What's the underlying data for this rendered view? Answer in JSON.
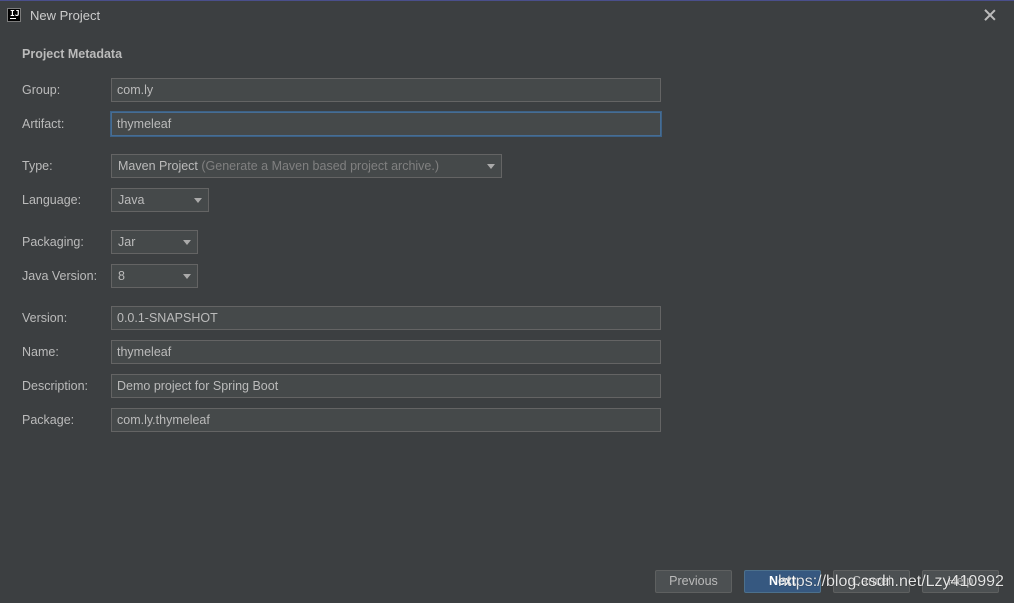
{
  "window": {
    "title": "New Project",
    "app_icon": "intellij-idea-icon"
  },
  "section_title": "Project Metadata",
  "fields": {
    "group": {
      "label": "Group:",
      "value": "com.ly"
    },
    "artifact": {
      "label": "Artifact:",
      "value": "thymeleaf"
    },
    "type": {
      "label": "Type:",
      "value": "Maven Project",
      "hint": "(Generate a Maven based project archive.)"
    },
    "language": {
      "label": "Language:",
      "value": "Java"
    },
    "packaging": {
      "label": "Packaging:",
      "value": "Jar"
    },
    "java_version": {
      "label": "Java Version:",
      "value": "8"
    },
    "version": {
      "label": "Version:",
      "value": "0.0.1-SNAPSHOT"
    },
    "name": {
      "label": "Name:",
      "value": "thymeleaf"
    },
    "description": {
      "label": "Description:",
      "value": "Demo project for Spring Boot"
    },
    "package": {
      "label": "Package:",
      "value": "com.ly.thymeleaf"
    }
  },
  "buttons": {
    "previous": "Previous",
    "next": "Next",
    "cancel": "Cancel",
    "help": "Help"
  },
  "watermark": "https://blog.csdn.net/Lzy410992",
  "colors": {
    "background": "#3c3f41",
    "field_background": "#45494a",
    "focus_border": "#466d94",
    "primary_button": "#365880"
  }
}
